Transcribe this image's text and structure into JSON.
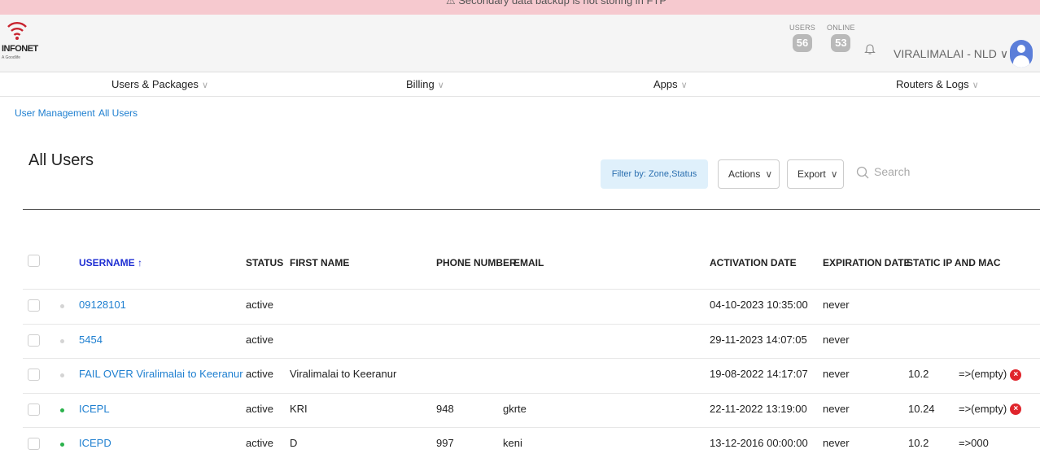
{
  "banner": {
    "message": "⚠ Secondary data backup is not storing in FTP"
  },
  "brand": {
    "name": "INFONET",
    "tagline": "A Goodlife"
  },
  "header": {
    "users_label": "USERS",
    "users_count": "56",
    "online_label": "ONLINE",
    "online_count": "53",
    "zone": "VIRALIMALAI - NLD"
  },
  "nav": [
    {
      "label": "Users & Packages"
    },
    {
      "label": "Billing"
    },
    {
      "label": "Apps"
    },
    {
      "label": "Routers & Logs"
    }
  ],
  "breadcrumb": {
    "parent": "User Management",
    "current": "All Users"
  },
  "page": {
    "title": "All Users"
  },
  "toolbar": {
    "filter_label": "Filter by: Zone,Status",
    "actions_label": "Actions",
    "export_label": "Export",
    "search_placeholder": "Search"
  },
  "table": {
    "headers": {
      "username": "USERNAME ↑",
      "status": "STATUS",
      "first_name": "FIRST NAME",
      "phone": "PHONE NUMBER",
      "email": "EMAIL",
      "activation": "ACTIVATION DATE",
      "expiration": "EXPIRATION DATE",
      "static_ip": "STATIC IP AND MAC"
    },
    "rows": [
      {
        "online": false,
        "username": "09128101",
        "status": "active",
        "first_name": "",
        "phone": "",
        "email": "",
        "activation": "04-10-2023 10:35:00",
        "expiration": "never",
        "ip": "",
        "mac": "",
        "bad": false
      },
      {
        "online": false,
        "username": "5454",
        "status": "active",
        "first_name": "",
        "phone": "",
        "email": "",
        "activation": "29-11-2023 14:07:05",
        "expiration": "never",
        "ip": "",
        "mac": "",
        "bad": false
      },
      {
        "online": false,
        "username": "FAIL OVER Viralimalai to Keeranur",
        "status": "active",
        "first_name": "Viralimalai to Keeranur",
        "phone": "",
        "email": "",
        "activation": "19-08-2022 14:17:07",
        "expiration": "never",
        "ip": "10.2",
        "mac": "=>(empty)",
        "bad": true
      },
      {
        "online": true,
        "username": "ICEPL",
        "status": "active",
        "first_name": "KRI",
        "phone": "948",
        "email": "gkrte",
        "activation": "22-11-2022 13:19:00",
        "expiration": "never",
        "ip": "10.24",
        "mac": "=>(empty)",
        "bad": true
      },
      {
        "online": true,
        "username": "ICEPD",
        "status": "active",
        "first_name": "D",
        "phone": "997",
        "email": "keni",
        "activation": "13-12-2016 00:00:00",
        "expiration": "never",
        "ip": "10.2",
        "mac": "=>000",
        "bad": false
      }
    ]
  },
  "colors": {
    "link": "#1e7fd0",
    "online_dot": "#2bb24c",
    "offline_dot": "#d4d4d4",
    "error": "#e0252c",
    "banner": "#f6c9cf"
  },
  "icons": {
    "brand": "wifi-icon",
    "bell": "bell-icon",
    "search": "search-icon",
    "avatar": "user-avatar-icon",
    "error": "error-x-icon",
    "dropdown": "chevron-down-icon"
  }
}
